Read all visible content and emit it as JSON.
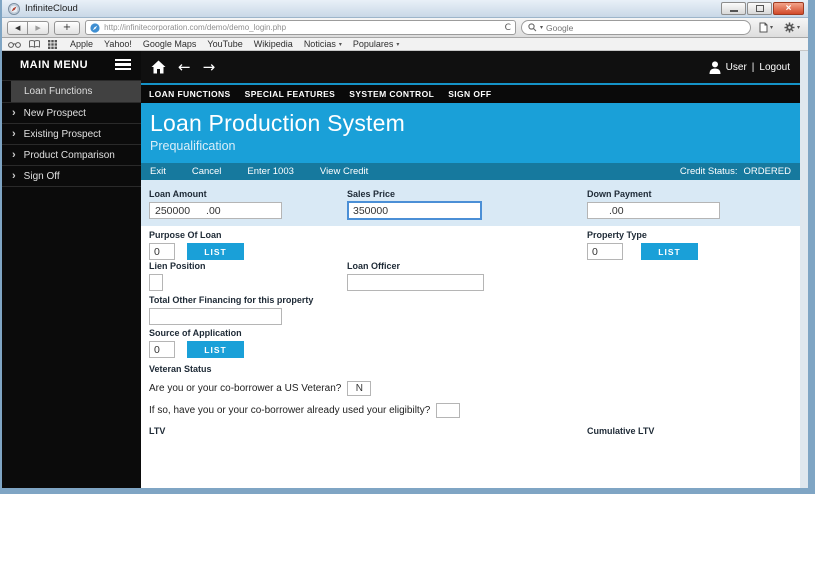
{
  "window": {
    "title": "InfiniteCloud"
  },
  "browser": {
    "url": "http://infinitecorporation.com/demo/demo_login.php",
    "search_placeholder": "Google",
    "bookmarks": [
      "Apple",
      "Yahoo!",
      "Google Maps",
      "YouTube",
      "Wikipedia",
      "Noticias",
      "Populares"
    ]
  },
  "icons": {
    "back": "◀",
    "forward": "▶",
    "new_tab": "+",
    "caret_down": "▾",
    "arrow_left": "←",
    "arrow_right": "→",
    "chevron_right": "›",
    "close": "×",
    "reload": "C"
  },
  "sidebar": {
    "title": "MAIN MENU",
    "items": [
      {
        "label": "Loan Functions"
      },
      {
        "label": "New Prospect"
      },
      {
        "label": "Existing Prospect"
      },
      {
        "label": "Product Comparison"
      },
      {
        "label": "Sign Off"
      }
    ]
  },
  "topbar": {
    "user": "User",
    "divider": "|",
    "logout": "Logout"
  },
  "menu": {
    "items": [
      "LOAN FUNCTIONS",
      "SPECIAL FEATURES",
      "SYSTEM CONTROL",
      "SIGN OFF"
    ]
  },
  "header": {
    "title": "Loan Production System",
    "subtitle": "Prequalification"
  },
  "actionbar": {
    "links": [
      "Exit",
      "Cancel",
      "Enter 1003",
      "View Credit"
    ],
    "status_label": "Credit Status:",
    "status_value": "ORDERED"
  },
  "form": {
    "loan_amount": {
      "label": "Loan Amount",
      "whole": "250000",
      "cents": ".00"
    },
    "sales_price": {
      "label": "Sales Price",
      "value": "350000"
    },
    "down_payment": {
      "label": "Down Payment",
      "whole": "",
      "cents": ".00"
    },
    "purpose_of_loan": {
      "label": "Purpose Of Loan",
      "value": "0",
      "list_label": "LIST"
    },
    "property_type": {
      "label": "Property Type",
      "value": "0",
      "list_label": "LIST"
    },
    "lien_position": {
      "label": "Lien Position",
      "value": ""
    },
    "loan_officer": {
      "label": "Loan Officer",
      "value": ""
    },
    "total_other_financing": {
      "label": "Total Other Financing for this property",
      "value": ""
    },
    "source_of_application": {
      "label": "Source of Application",
      "value": "0",
      "list_label": "LIST"
    },
    "veteran": {
      "label": "Veteran Status",
      "q1": "Are you or your co-borrower a US Veteran?",
      "q1_value": "N",
      "q2": "If so, have you or your co-borrower already used your eligibilty?",
      "q2_value": ""
    },
    "ltv_label": "LTV",
    "cumulative_ltv_label": "Cumulative LTV"
  },
  "colors": {
    "header_blue": "#1aa0d8",
    "actionbar_blue": "#16799e",
    "row_blue": "#d9e9f5",
    "list_button_blue": "#1aa0d8",
    "sidebar_black": "#0b0b0b"
  }
}
